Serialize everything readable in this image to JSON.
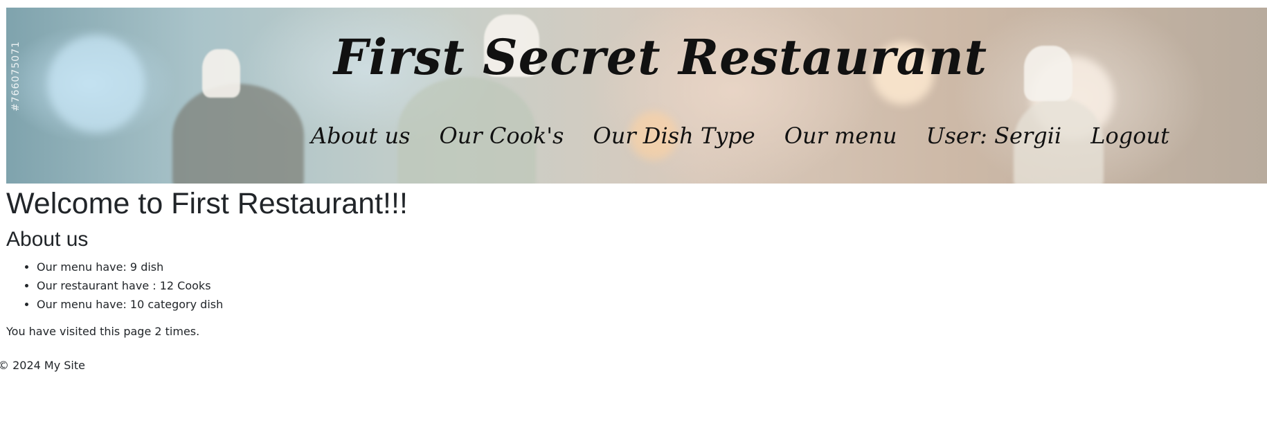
{
  "header": {
    "title": "First Secret Restaurant",
    "watermark": "#766075071",
    "nav": [
      {
        "label": "About us"
      },
      {
        "label": "Our Cook's"
      },
      {
        "label": "Our Dish Type"
      },
      {
        "label": "Our menu"
      },
      {
        "label": "User: Sergii"
      },
      {
        "label": "Logout"
      }
    ]
  },
  "main": {
    "heading": "Welcome to First Restaurant!!!",
    "subheading": "About us",
    "facts": [
      "Our menu have: 9 dish",
      "Our restaurant have : 12 Cooks",
      "Our menu have: 10 category dish"
    ],
    "visits": "You have visited this page 2 times."
  },
  "footer": {
    "text": "© 2024 My Site"
  }
}
